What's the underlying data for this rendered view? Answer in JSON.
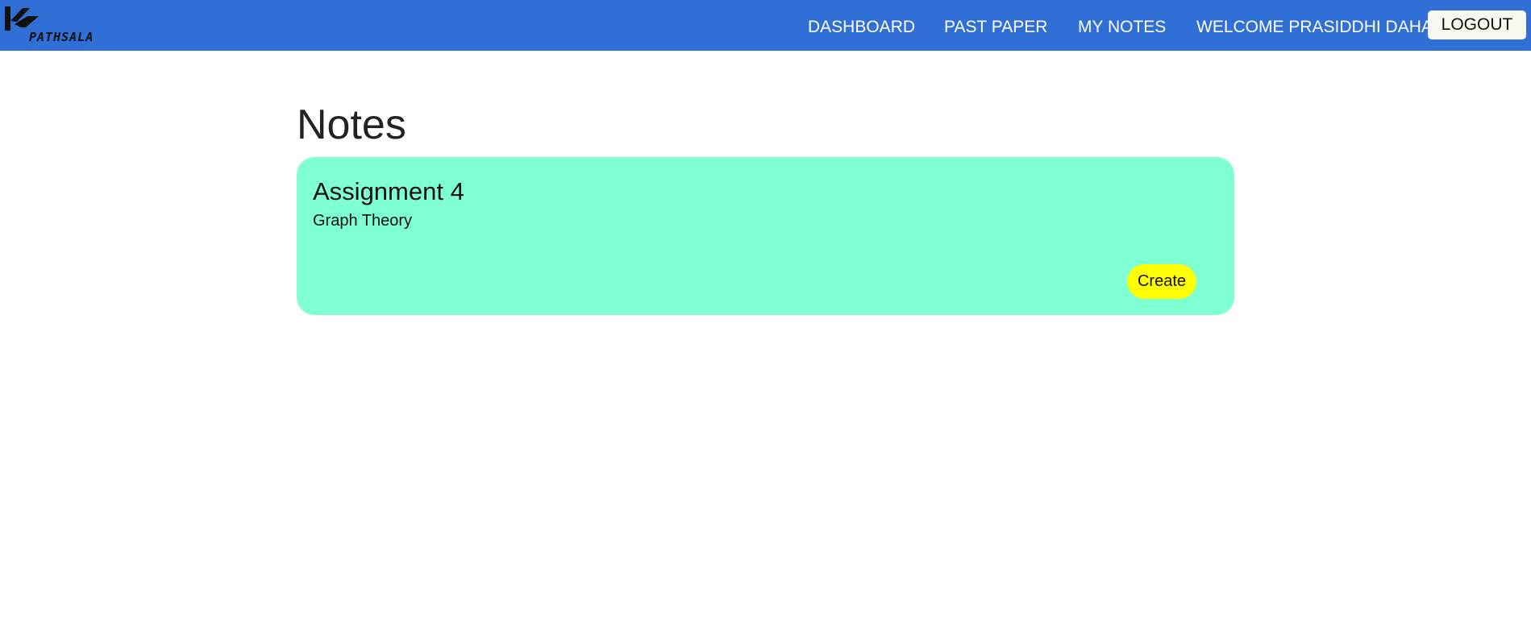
{
  "header": {
    "logo": {
      "icon": "kz-logo-icon",
      "text": "PATHSALA"
    },
    "nav": [
      {
        "label": "DASHBOARD"
      },
      {
        "label": "PAST PAPER"
      },
      {
        "label": "MY NOTES"
      }
    ],
    "welcome": "WELCOME PRASIDDHI DAHAL",
    "logout_label": "LOGOUT"
  },
  "main": {
    "title": "Notes",
    "notes": [
      {
        "title": "Assignment 4",
        "subtitle": "Graph Theory",
        "action_label": "Create"
      }
    ]
  },
  "colors": {
    "navbar": "#2f6fd6",
    "card": "#7fffd4",
    "create_button": "#ffff00",
    "logout_button": "#faf7f0"
  }
}
